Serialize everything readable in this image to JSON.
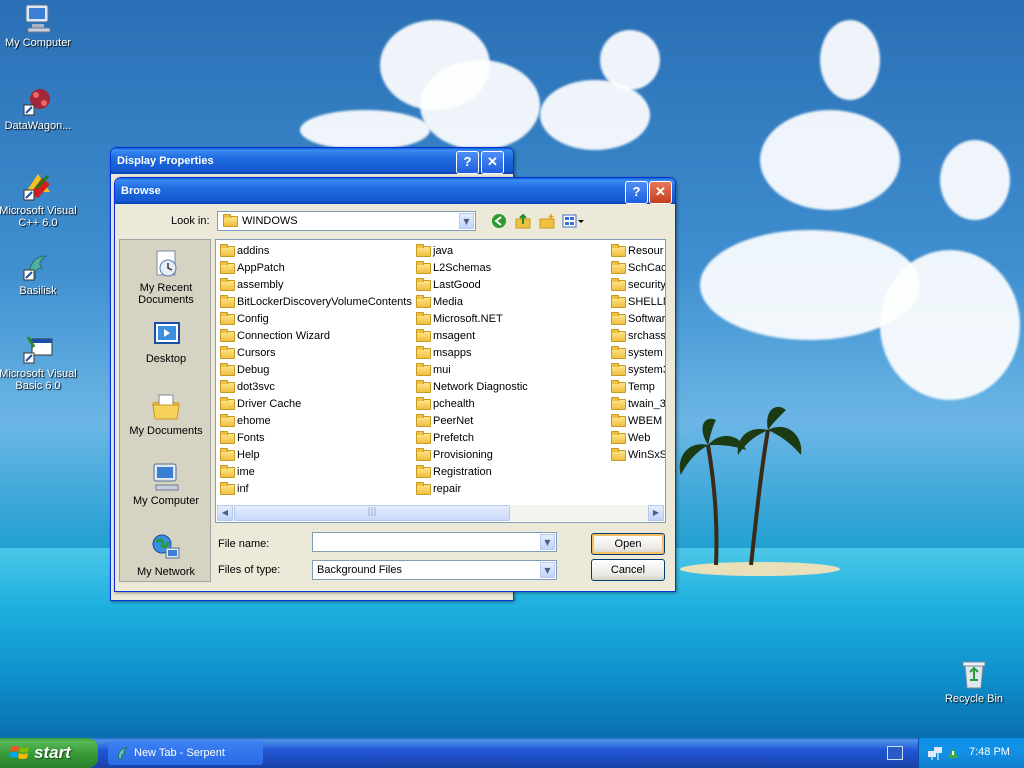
{
  "desktop": {
    "icons": [
      {
        "label": "My Computer",
        "icon": "my-computer-icon"
      },
      {
        "label": "DataWagon...",
        "icon": "datawagon-icon"
      },
      {
        "label": "Microsoft Visual C++ 6.0",
        "icon": "visual-cpp-icon"
      },
      {
        "label": "Basilisk",
        "icon": "basilisk-icon"
      },
      {
        "label": "Microsoft Visual Basic 6.0",
        "icon": "visual-basic-icon"
      },
      {
        "label": "Recycle Bin",
        "icon": "recycle-bin-icon"
      }
    ]
  },
  "display_properties": {
    "title": "Display Properties",
    "help": "?",
    "close": "✕"
  },
  "browse": {
    "title": "Browse",
    "help": "?",
    "close": "✕",
    "look_in_label": "Look in:",
    "look_in_value": "WINDOWS",
    "places": [
      {
        "label": "My Recent Documents",
        "icon": "recent-documents-icon"
      },
      {
        "label": "Desktop",
        "icon": "desktop-icon"
      },
      {
        "label": "My Documents",
        "icon": "my-documents-icon"
      },
      {
        "label": "My Computer",
        "icon": "my-computer-icon"
      },
      {
        "label": "My Network",
        "icon": "my-network-icon"
      }
    ],
    "columns": [
      [
        "addins",
        "AppPatch",
        "assembly",
        "BitLockerDiscoveryVolumeContents",
        "Config",
        "Connection Wizard",
        "Cursors",
        "Debug",
        "dot3svc",
        "Driver Cache",
        "ehome",
        "Fonts",
        "Help",
        "ime",
        "inf"
      ],
      [
        "java",
        "L2Schemas",
        "LastGood",
        "Media",
        "Microsoft.NET",
        "msagent",
        "msapps",
        "mui",
        "Network Diagnostic",
        "pchealth",
        "PeerNet",
        "Prefetch",
        "Provisioning",
        "Registration",
        "repair"
      ],
      [
        "Resour",
        "SchCacl",
        "security",
        "SHELLN",
        "Softwar",
        "srchass",
        "system",
        "system3",
        "Temp",
        "twain_3",
        "WBEM",
        "Web",
        "WinSxS"
      ]
    ],
    "file_name_label": "File name:",
    "file_name_value": "",
    "files_of_type_label": "Files of type:",
    "files_of_type_value": "Background Files",
    "open_label": "Open",
    "cancel_label": "Cancel"
  },
  "taskbar": {
    "start_label": "start",
    "task_label": "New Tab - Serpent",
    "clock": "7:48 PM"
  }
}
